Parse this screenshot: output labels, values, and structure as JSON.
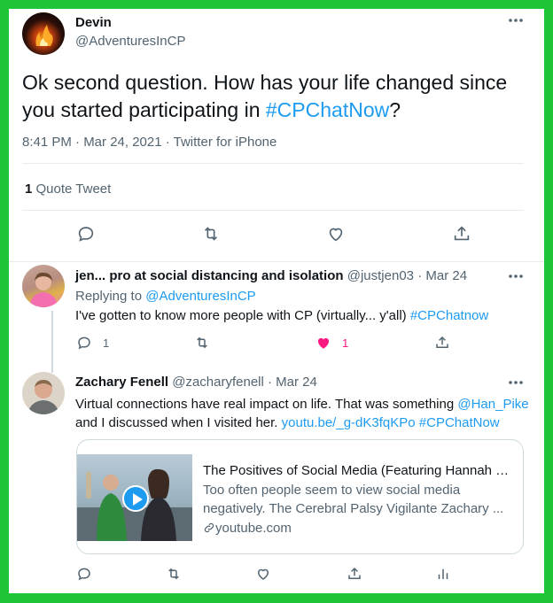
{
  "main_tweet": {
    "author_name": "Devin",
    "author_handle": "@AdventuresInCP",
    "text_before": "Ok second question. How has your life changed since you started participating in ",
    "hashtag": "#CPChatNow",
    "text_after": "?",
    "timestamp": "8:41 PM · Mar 24, 2021 · Twitter for iPhone",
    "quote_count": "1",
    "quote_label": "Quote Tweet",
    "more_icon": "more-horizontal-icon"
  },
  "reply1": {
    "author_name": "jen... pro at social distancing and isolation",
    "author_handle": "@justjen03",
    "date": "Mar 24",
    "replying_prefix": "Replying to ",
    "replying_to": "@AdventuresInCP",
    "text": "I've gotten to know more people with CP (virtually... y'all) ",
    "hashtag": "#CPChatnow",
    "reply_count": "1",
    "like_count": "1",
    "like_color": "#f91880"
  },
  "reply2": {
    "author_name": "Zachary Fenell",
    "author_handle": "@zacharyfenell",
    "date": "Mar 24",
    "text_line1": "Virtual connections have real impact on life. That was something ",
    "mention": "@Han_Pike",
    "text_line2": "and I discussed when I visited her. ",
    "link": "youtu.be/_g-dK3fqKPo",
    "hashtag": "#CPChatNow",
    "card": {
      "title": "The Positives of Social Media (Featuring Hannah Pi...",
      "description_line1": "Too often people seem to view social media",
      "description_line2": "negatively. The Cerebral Palsy Vigilante Zachary ...",
      "domain": "youtube.com"
    }
  },
  "colors": {
    "accent": "#1d9bf0",
    "border_frame": "#1ec637",
    "text_secondary": "#536471"
  }
}
